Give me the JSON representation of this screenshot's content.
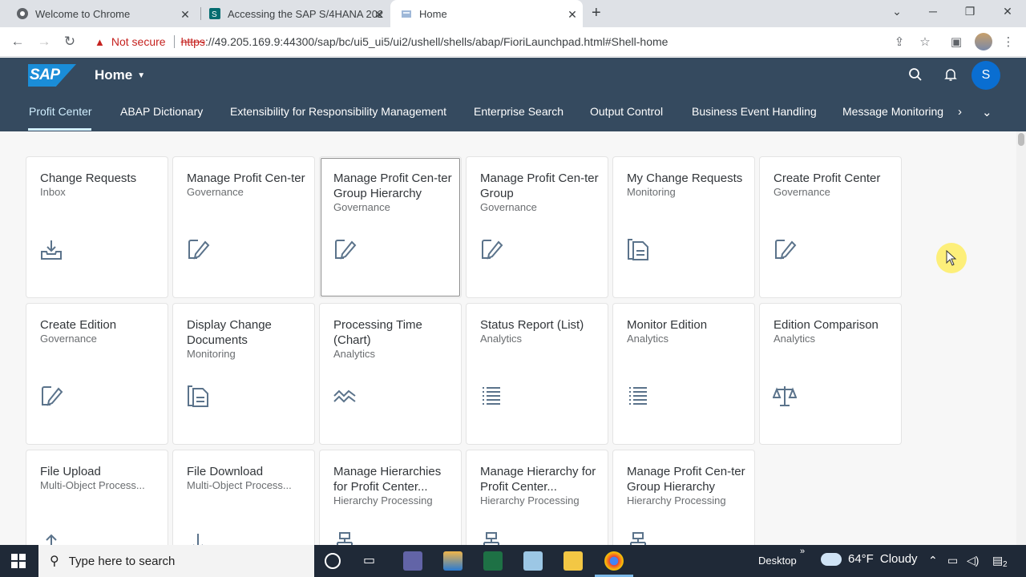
{
  "browser": {
    "tabs": [
      {
        "title": "Welcome to Chrome",
        "active": false
      },
      {
        "title": "Accessing the SAP S/4HANA 202",
        "active": false
      },
      {
        "title": "Home",
        "active": true
      }
    ],
    "new_tab_label": "+",
    "security_label": "Not secure",
    "url_scheme": "https",
    "url_rest": "://49.205.169.9:44300/sap/bc/ui5_ui5/ui2/ushell/shells/abap/FioriLaunchpad.html#Shell-home"
  },
  "shell": {
    "logo_text": "SAP",
    "title": "Home",
    "avatar_initial": "S",
    "nav_tabs": [
      "Profit Center",
      "ABAP Dictionary",
      "Extensibility for Responsibility Management",
      "Enterprise Search",
      "Output Control",
      "Business Event Handling",
      "Message Monitoring"
    ]
  },
  "tiles": [
    {
      "title": "Change Requests",
      "subtitle": "Inbox",
      "icon": "inbox-download-icon"
    },
    {
      "title": "Manage Profit Cen-ter",
      "subtitle": "Governance",
      "icon": "edit-icon"
    },
    {
      "title": "Manage Profit Cen-ter Group Hierarchy",
      "subtitle": "Governance",
      "icon": "edit-icon"
    },
    {
      "title": "Manage Profit Cen-ter Group",
      "subtitle": "Governance",
      "icon": "edit-icon"
    },
    {
      "title": "My Change Requests",
      "subtitle": "Monitoring",
      "icon": "document-icon"
    },
    {
      "title": "Create Profit Center",
      "subtitle": "Governance",
      "icon": "edit-icon"
    },
    {
      "title": "Create Edition",
      "subtitle": "Governance",
      "icon": "edit-icon"
    },
    {
      "title": "Display Change Documents",
      "subtitle": "Monitoring",
      "icon": "document-icon"
    },
    {
      "title": "Processing Time (Chart)",
      "subtitle": "Analytics",
      "icon": "line-chart-icon"
    },
    {
      "title": "Status Report (List)",
      "subtitle": "Analytics",
      "icon": "list-icon"
    },
    {
      "title": "Monitor Edition",
      "subtitle": "Analytics",
      "icon": "list-icon"
    },
    {
      "title": "Edition Comparison",
      "subtitle": "Analytics",
      "icon": "compare-scale-icon"
    },
    {
      "title": "File Upload",
      "subtitle": "Multi-Object Process...",
      "icon": "upload-icon"
    },
    {
      "title": "File Download",
      "subtitle": "Multi-Object Process...",
      "icon": "download-icon"
    },
    {
      "title": "Manage Hierarchies for Profit Center...",
      "subtitle": "Hierarchy Processing",
      "icon": "hierarchy-icon"
    },
    {
      "title": "Manage Hierarchy for Profit Center...",
      "subtitle": "Hierarchy Processing",
      "icon": "hierarchy-icon"
    },
    {
      "title": "Manage Profit Cen-ter Group Hierarchy",
      "subtitle": "Hierarchy Processing",
      "icon": "hierarchy-icon"
    }
  ],
  "taskbar": {
    "search_placeholder": "Type here to search",
    "desktop_label": "Desktop",
    "weather_temp": "64°F",
    "weather_text": "Cloudy",
    "notification_count": "2"
  },
  "colors": {
    "shell_bg": "#354a5f",
    "accent": "#0a6ed1",
    "tile_icon": "#5b738b"
  }
}
